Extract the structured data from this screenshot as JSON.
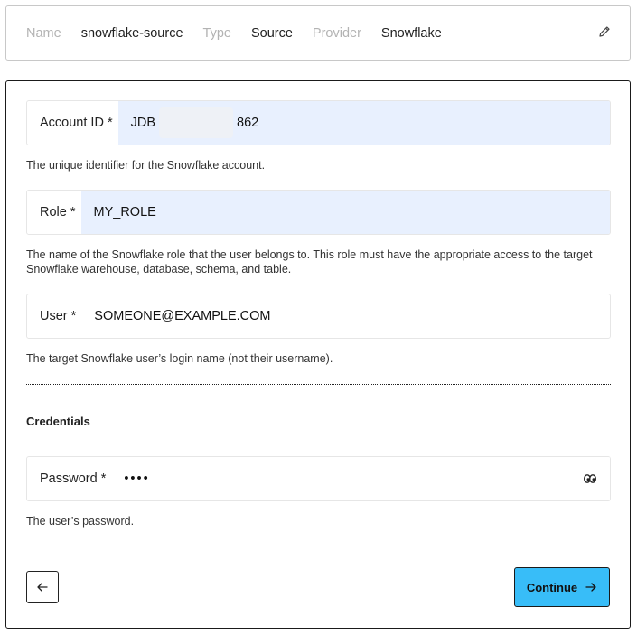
{
  "summary": {
    "name_label": "Name",
    "name_value": "snowflake-source",
    "type_label": "Type",
    "type_value": "Source",
    "provider_label": "Provider",
    "provider_value": "Snowflake",
    "edit_icon": "pencil-icon"
  },
  "form": {
    "account_id": {
      "label": "Account ID *",
      "value_prefix": "JDB",
      "value_suffix": "862",
      "help": "The unique identifier for the Snowflake account."
    },
    "role": {
      "label": "Role *",
      "value": "MY_ROLE",
      "help": "The name of the Snowflake role that the user belongs to. This role must have the appropriate access to the target Snowflake warehouse, database, schema, and table."
    },
    "user": {
      "label": "User *",
      "value": "SOMEONE@EXAMPLE.COM",
      "help": "The target Snowflake user’s login name (not their username)."
    },
    "credentials_title": "Credentials",
    "password": {
      "label": "Password *",
      "value": "••••",
      "help": "The user’s password.",
      "reveal_icon": "eyes-icon"
    }
  },
  "footer": {
    "back_icon": "arrow-left-icon",
    "continue_label": "Continue",
    "continue_icon": "arrow-right-icon",
    "continue_color": "#38bdf8"
  },
  "colors": {
    "autofill_bg": "#e8f0fe",
    "muted_label": "#b3b3b3"
  }
}
